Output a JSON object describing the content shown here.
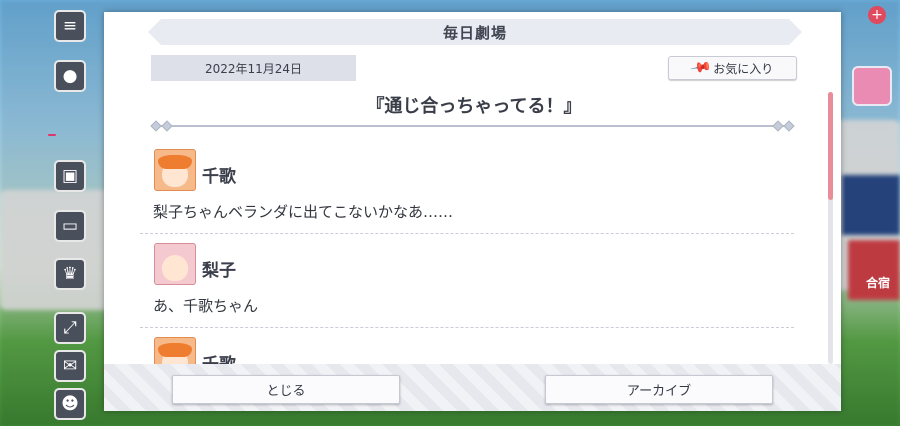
{
  "dialog": {
    "title": "毎日劇場",
    "date": "2022年11月24日",
    "favorite_label": "お気に入り",
    "story_title": "『通じ合っちゃってる！』",
    "entries": [
      {
        "speaker": "千歌",
        "line": "梨子ちゃんベランダに出てこないかなあ……",
        "avatar": "chika-avatar"
      },
      {
        "speaker": "梨子",
        "line": "あ、千歌ちゃん",
        "avatar": "riko-avatar"
      },
      {
        "speaker": "千歌",
        "line": "",
        "avatar": "chika-avatar"
      }
    ],
    "close_label": "とじる",
    "archive_label": "アーカイブ"
  },
  "background": {
    "right_label": "合宿"
  },
  "colors": {
    "accent_scroll": "#e98d99",
    "title_bar": "#e9ebf2",
    "date_box": "#dde0e9"
  }
}
